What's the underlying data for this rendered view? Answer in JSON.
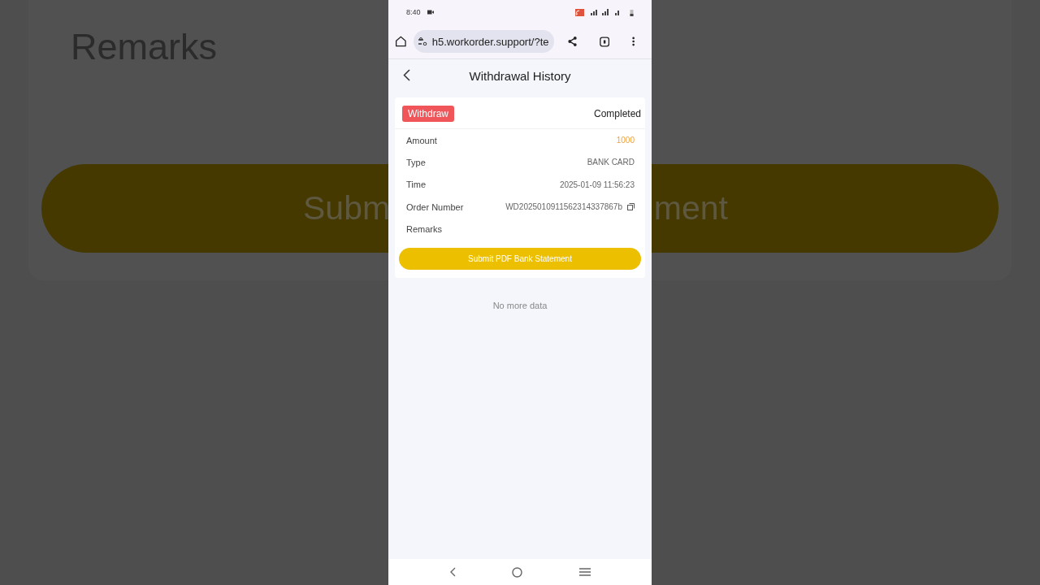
{
  "backdrop": {
    "label": "Remarks",
    "button_left_text": "Subm",
    "button_right_text": "ment"
  },
  "status_bar": {
    "time": "8:40"
  },
  "browser": {
    "url": "h5.workorder.support/?te"
  },
  "header": {
    "title": "Withdrawal History"
  },
  "record": {
    "tag": "Withdraw",
    "status": "Completed",
    "fields": [
      {
        "label": "Amount",
        "value": "1000",
        "kind": "amount"
      },
      {
        "label": "Type",
        "value": "BANK CARD",
        "kind": "text"
      },
      {
        "label": "Time",
        "value": "2025-01-09 11:56:23",
        "kind": "text"
      },
      {
        "label": "Order Number",
        "value": "WD2025010911562314337867b",
        "kind": "copy"
      },
      {
        "label": "Remarks"
      }
    ],
    "button": "Submit PDF Bank Statement"
  },
  "footer_text": "No more data"
}
